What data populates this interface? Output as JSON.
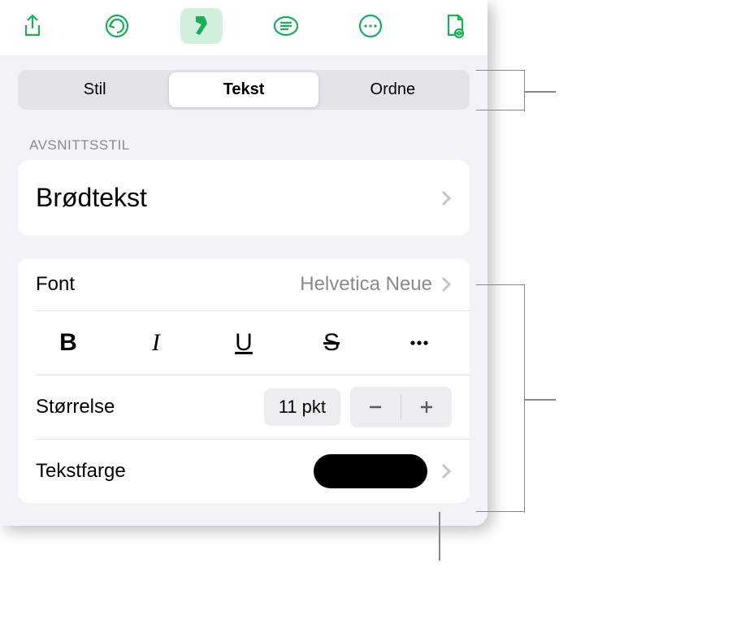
{
  "toolbar_icons": [
    "share",
    "undo",
    "format",
    "comment",
    "more",
    "document-view"
  ],
  "tabs": {
    "items": [
      "Stil",
      "Tekst",
      "Ordne"
    ],
    "selected": 1
  },
  "section_label": "AVSNITTSSTIL",
  "paragraph_style": "Brødtekst",
  "font": {
    "label": "Font",
    "value": "Helvetica Neue"
  },
  "style_buttons": {
    "bold": "B",
    "italic": "I",
    "underline": "U",
    "strike": "S"
  },
  "size": {
    "label": "Størrelse",
    "value": "11 pkt"
  },
  "text_color": {
    "label": "Tekstfarge",
    "value": "#000000"
  }
}
